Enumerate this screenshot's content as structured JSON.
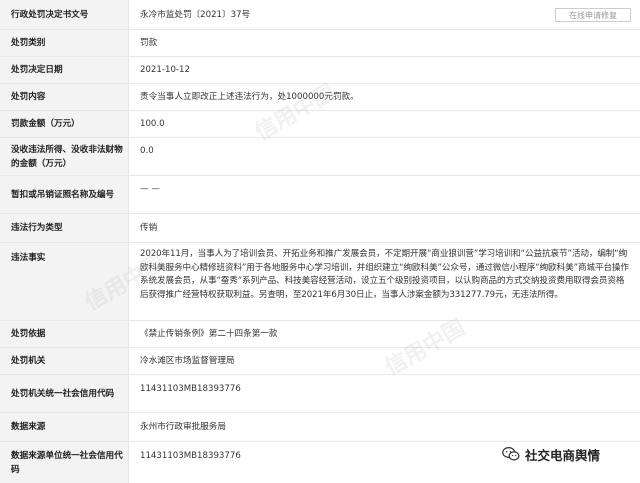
{
  "rows": [
    {
      "label": "行政处罚决定书文号",
      "value": "永冷市监处罚〔2021〕37号"
    },
    {
      "label": "处罚类别",
      "value": "罚款"
    },
    {
      "label": "处罚决定日期",
      "value": "2021-10-12"
    },
    {
      "label": "处罚内容",
      "value": "责令当事人立即改正上述违法行为，处1000000元罚款。"
    },
    {
      "label": "罚款金额（万元）",
      "value": "100.0"
    },
    {
      "label": "没收违法所得、没收非法财物的金额（万元）",
      "value": "0.0"
    },
    {
      "label": "暂扣或吊销证照名称及编号",
      "value": "— —"
    },
    {
      "label": "违法行为类型",
      "value": "传销"
    },
    {
      "label": "违法事实",
      "value": "2020年11月，当事人为了培训会员、开拓业务和推广发展会员，不定期开展“商业狼训营”学习培训和“公益抗衰节”活动，编制“绚欧科美服务中心精修班资料”用于各地服务中心学习培训，并组织建立“绚欧科美”公众号，通过微信小程序“绚欧科美”商城平台操作系统发展会员，从事“蚕秀”系列产品、科技美容经营活动，设立五个级别投资项目，以认购商品的方式交纳投资费用取得会员资格后获得推广经营特权获取利益。另查明，至2021年6月30日止，当事人涉案金额为331277.79元，无违法所得。"
    },
    {
      "label": "处罚依据",
      "value": "《禁止传销条例》第二十四条第一款"
    },
    {
      "label": "处罚机关",
      "value": "冷水滩区市场监督管理局"
    },
    {
      "label": "处罚机关统一社会信用代码",
      "value": "11431103MB18393776"
    },
    {
      "label": "数据来源",
      "value": "永州市行政审批服务局"
    },
    {
      "label": "数据来源单位统一社会信用代码",
      "value": "11431103MB18393776"
    }
  ],
  "repair_button": "在线申请修复",
  "watermark": "信用中国",
  "badge": {
    "text": "社交电商舆情",
    "icon": "wechat-icon"
  }
}
